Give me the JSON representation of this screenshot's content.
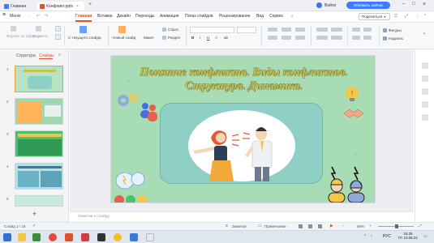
{
  "titlebar": {
    "home_tab": "Главная",
    "doc_tab": "Конфликт.pptx",
    "login": "Войти",
    "update_button": "Обновить сейчас"
  },
  "menubar": {
    "menu_label": "Меню",
    "items": [
      "Главная",
      "Вставка",
      "Дизайн",
      "Переходы",
      "Анимация",
      "Показ слайдов",
      "Рецензирование",
      "Вид",
      "Сервис"
    ],
    "share": "Поделиться"
  },
  "ribbon": {
    "format_painter": "Формат по образцу",
    "paste": "Вставить",
    "from_current": "С текущего слайда",
    "new_slide": "Новый слайд",
    "layout": "Макет",
    "reset": "Сброс",
    "section": "Раздел",
    "shapes": "Фигуры",
    "textbox": "Надпись"
  },
  "leftpanel": {
    "tab_structure": "Структура",
    "tab_slides": "Слайды",
    "thumbnails": [
      "1",
      "2",
      "3",
      "4",
      "5"
    ]
  },
  "slide": {
    "title_line1": "Понятие конфликта. Виды конфликтов.",
    "title_line2": "Структура. Динамика."
  },
  "notes": {
    "placeholder": "Заметки к слайду"
  },
  "statusbar": {
    "slide_counter": "Слайд 1 / 15",
    "notes_button": "Заметки",
    "comments_button": "Примечание",
    "zoom": "65%"
  },
  "taskbar": {
    "lang": "РУС",
    "time": "16:29",
    "date": "Пт 10.05.24"
  },
  "colors": {
    "accent": "#3d7bff",
    "active_tab": "#e0502a",
    "slide_bg": "#a8dcb5",
    "title_text": "#c8c24e"
  }
}
